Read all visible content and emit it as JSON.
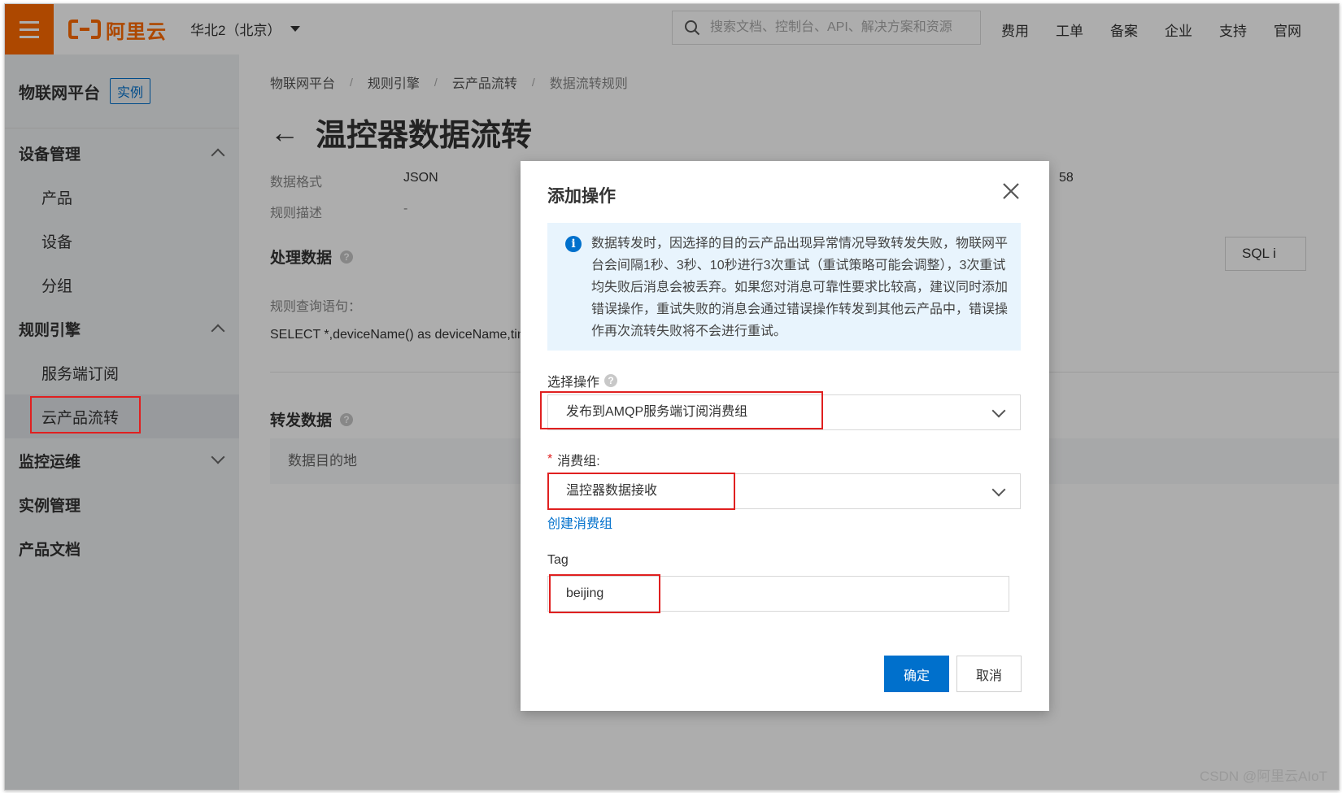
{
  "topbar": {
    "logo_text": "阿里云",
    "region": "华北2（北京）",
    "search_placeholder": "搜索文档、控制台、API、解决方案和资源",
    "nav": [
      "费用",
      "工单",
      "备案",
      "企业",
      "支持",
      "官网"
    ]
  },
  "sidebar": {
    "title": "物联网平台",
    "badge": "实例",
    "items": [
      {
        "label": "设备管理"
      },
      {
        "label": "产品"
      },
      {
        "label": "设备"
      },
      {
        "label": "分组"
      },
      {
        "label": "规则引擎"
      },
      {
        "label": "服务端订阅"
      },
      {
        "label": "云产品流转"
      },
      {
        "label": "监控运维"
      },
      {
        "label": "实例管理"
      },
      {
        "label": "产品文档"
      }
    ]
  },
  "main": {
    "breadcrumb": [
      "物联网平台",
      "规则引擎",
      "云产品流转",
      "数据流转规则"
    ],
    "breadcrumb_sep": "/",
    "title": "温控器数据流转",
    "back_arrow": "←",
    "data_format_label": "数据格式",
    "data_format_value": "JSON",
    "rule_desc_label": "规则描述",
    "rule_desc_value": "-",
    "partial_value": "58",
    "process_section": "处理数据",
    "query_label": "规则查询语句：",
    "query_value": "SELECT *,deviceName() as deviceName,tim",
    "sql_button": "SQL i",
    "forward_section": "转发数据",
    "table_header": "数据目的地"
  },
  "dialog": {
    "title": "添加操作",
    "notice_icon": "i",
    "notice": "数据转发时，因选择的目的云产品出现异常情况导致转发失败，物联网平台会间隔1秒、3秒、10秒进行3次重试（重试策略可能会调整），3次重试均失败后消息会被丢弃。如果您对消息可靠性要求比较高，建议同时添加错误操作，重试失败的消息会通过错误操作转发到其他云产品中，错误操作再次流转失败将不会进行重试。",
    "operation_label": "选择操作",
    "operation_value": "发布到AMQP服务端订阅消费组",
    "consumer_group_required": "*",
    "consumer_group_label": "消费组:",
    "consumer_group_value": "温控器数据接收",
    "create_group_link": "创建消费组",
    "tag_label": "Tag",
    "tag_value": "beijing",
    "confirm_button": "确定",
    "cancel_button": "取消"
  },
  "watermark": "CSDN @阿里云AIoT",
  "colors": {
    "brand": "#ff6a00",
    "primary": "#0070cc",
    "highlight": "#e02020",
    "notice_bg": "#e8f4fd"
  }
}
